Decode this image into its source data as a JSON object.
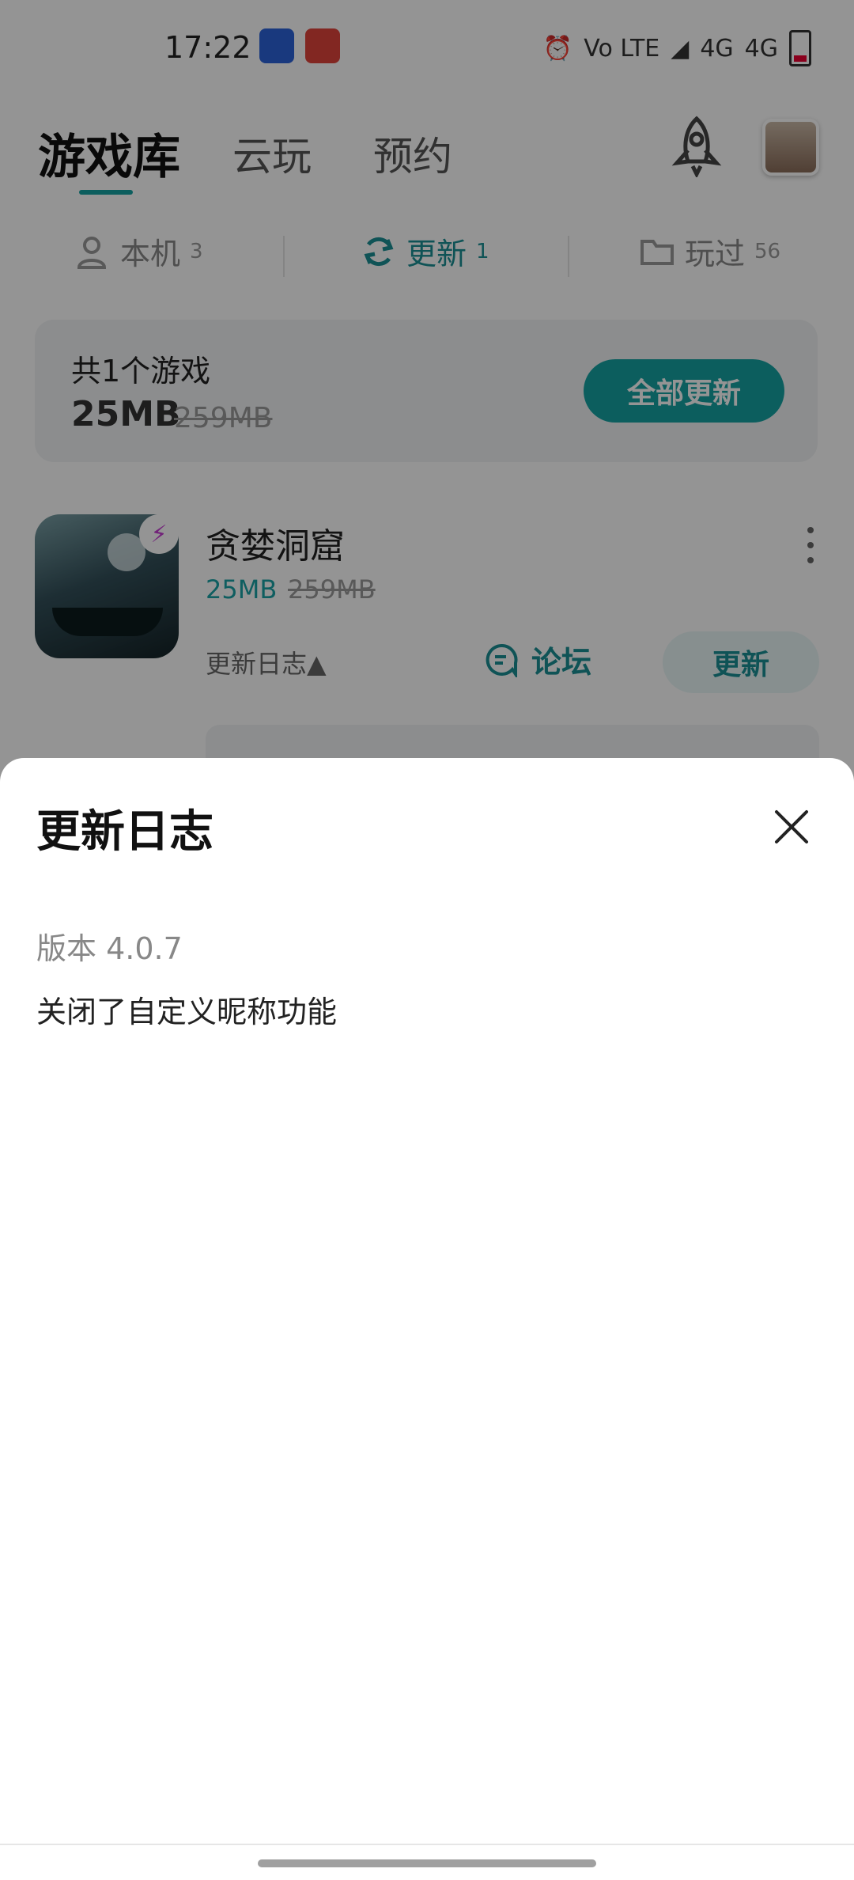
{
  "status_bar": {
    "time": "17:22",
    "signals": [
      "Vo LTE",
      "4G",
      "4G"
    ],
    "icons": [
      "alarm-icon",
      "wifi-icon",
      "signal-icon",
      "battery-icon"
    ]
  },
  "top_nav": {
    "tabs": [
      {
        "label": "游戏库",
        "active": true
      },
      {
        "label": "云玩",
        "active": false
      },
      {
        "label": "预约",
        "active": false
      }
    ],
    "icons": [
      "rocket-icon",
      "avatar"
    ]
  },
  "sub_tabs": [
    {
      "label": "本机",
      "count": "3",
      "icon": "person-icon",
      "active": false
    },
    {
      "label": "更新",
      "count": "1",
      "icon": "refresh-icon",
      "active": true
    },
    {
      "label": "玩过",
      "count": "56",
      "icon": "folder-icon",
      "active": false
    }
  ],
  "summary": {
    "title": "共1个游戏",
    "size": "25MB",
    "original_size": "259MB",
    "update_all_label": "全部更新"
  },
  "game": {
    "name": "贪婪洞窟",
    "size": "25MB",
    "original_size": "259MB",
    "changelog_label": "更新日志▲",
    "forum_label": "论坛",
    "update_label": "更新"
  },
  "sheet": {
    "title": "更新日志",
    "version": "版本 4.0.7",
    "changes": "关闭了自定义昵称功能"
  },
  "colors": {
    "accent": "#15a3a3",
    "overlay": "rgba(0,0,0,0.42)"
  }
}
